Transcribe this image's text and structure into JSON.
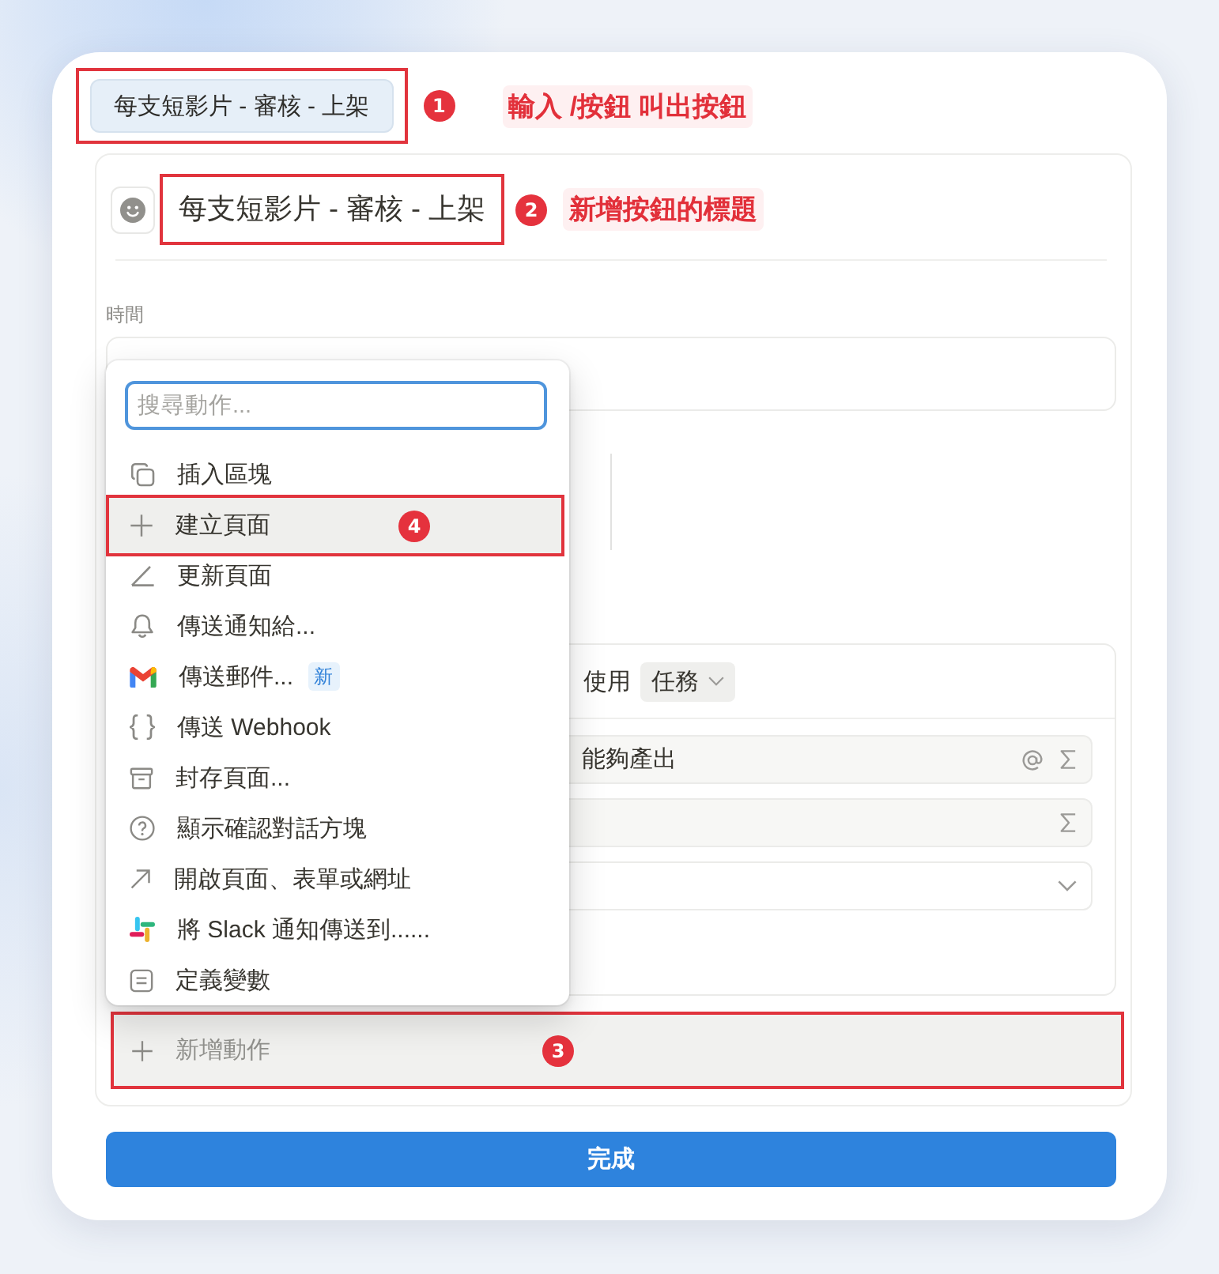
{
  "trigger_button": {
    "label": "每支短影片 - 審核 - 上架",
    "callout": {
      "number": "1",
      "note": "輸入 /按鈕 叫出按鈕"
    }
  },
  "editor": {
    "title": "每支短影片 - 審核 - 上架",
    "title_callout": {
      "number": "2",
      "note": "新增按鈕的標題"
    },
    "time_label": "時間"
  },
  "action_menu": {
    "search_placeholder": "搜尋動作...",
    "items": [
      {
        "kind": "copy",
        "label": "插入區塊",
        "selected": false
      },
      {
        "kind": "plus",
        "label": "建立頁面",
        "selected": true,
        "callout": {
          "number": "4"
        }
      },
      {
        "kind": "edit",
        "label": "更新頁面",
        "selected": false
      },
      {
        "kind": "bell",
        "label": "傳送通知給...",
        "selected": false
      },
      {
        "kind": "mail",
        "label": "傳送郵件...",
        "badge": "新",
        "selected": false
      },
      {
        "kind": "braces",
        "label": "傳送 Webhook",
        "selected": false
      },
      {
        "kind": "archive",
        "label": "封存頁面...",
        "selected": false
      },
      {
        "kind": "question",
        "label": "顯示確認對話方塊",
        "selected": false
      },
      {
        "kind": "arrow",
        "label": "開啟頁面、表單或網址",
        "selected": false
      },
      {
        "kind": "hash",
        "label": "將 Slack 通知傳送到......",
        "selected": false
      },
      {
        "kind": "list",
        "label": "定義變數",
        "selected": false
      }
    ]
  },
  "action_card": {
    "prefix": "使用",
    "database": "任務",
    "rows": [
      {
        "kind": "text",
        "value": "能夠產出",
        "mention": true,
        "formula": true
      },
      {
        "kind": "text",
        "mention": false,
        "formula": true
      },
      {
        "kind": "select"
      }
    ]
  },
  "add_action": {
    "label": "新增動作",
    "callout": {
      "number": "3"
    }
  },
  "done_button": {
    "label": "完成"
  }
}
